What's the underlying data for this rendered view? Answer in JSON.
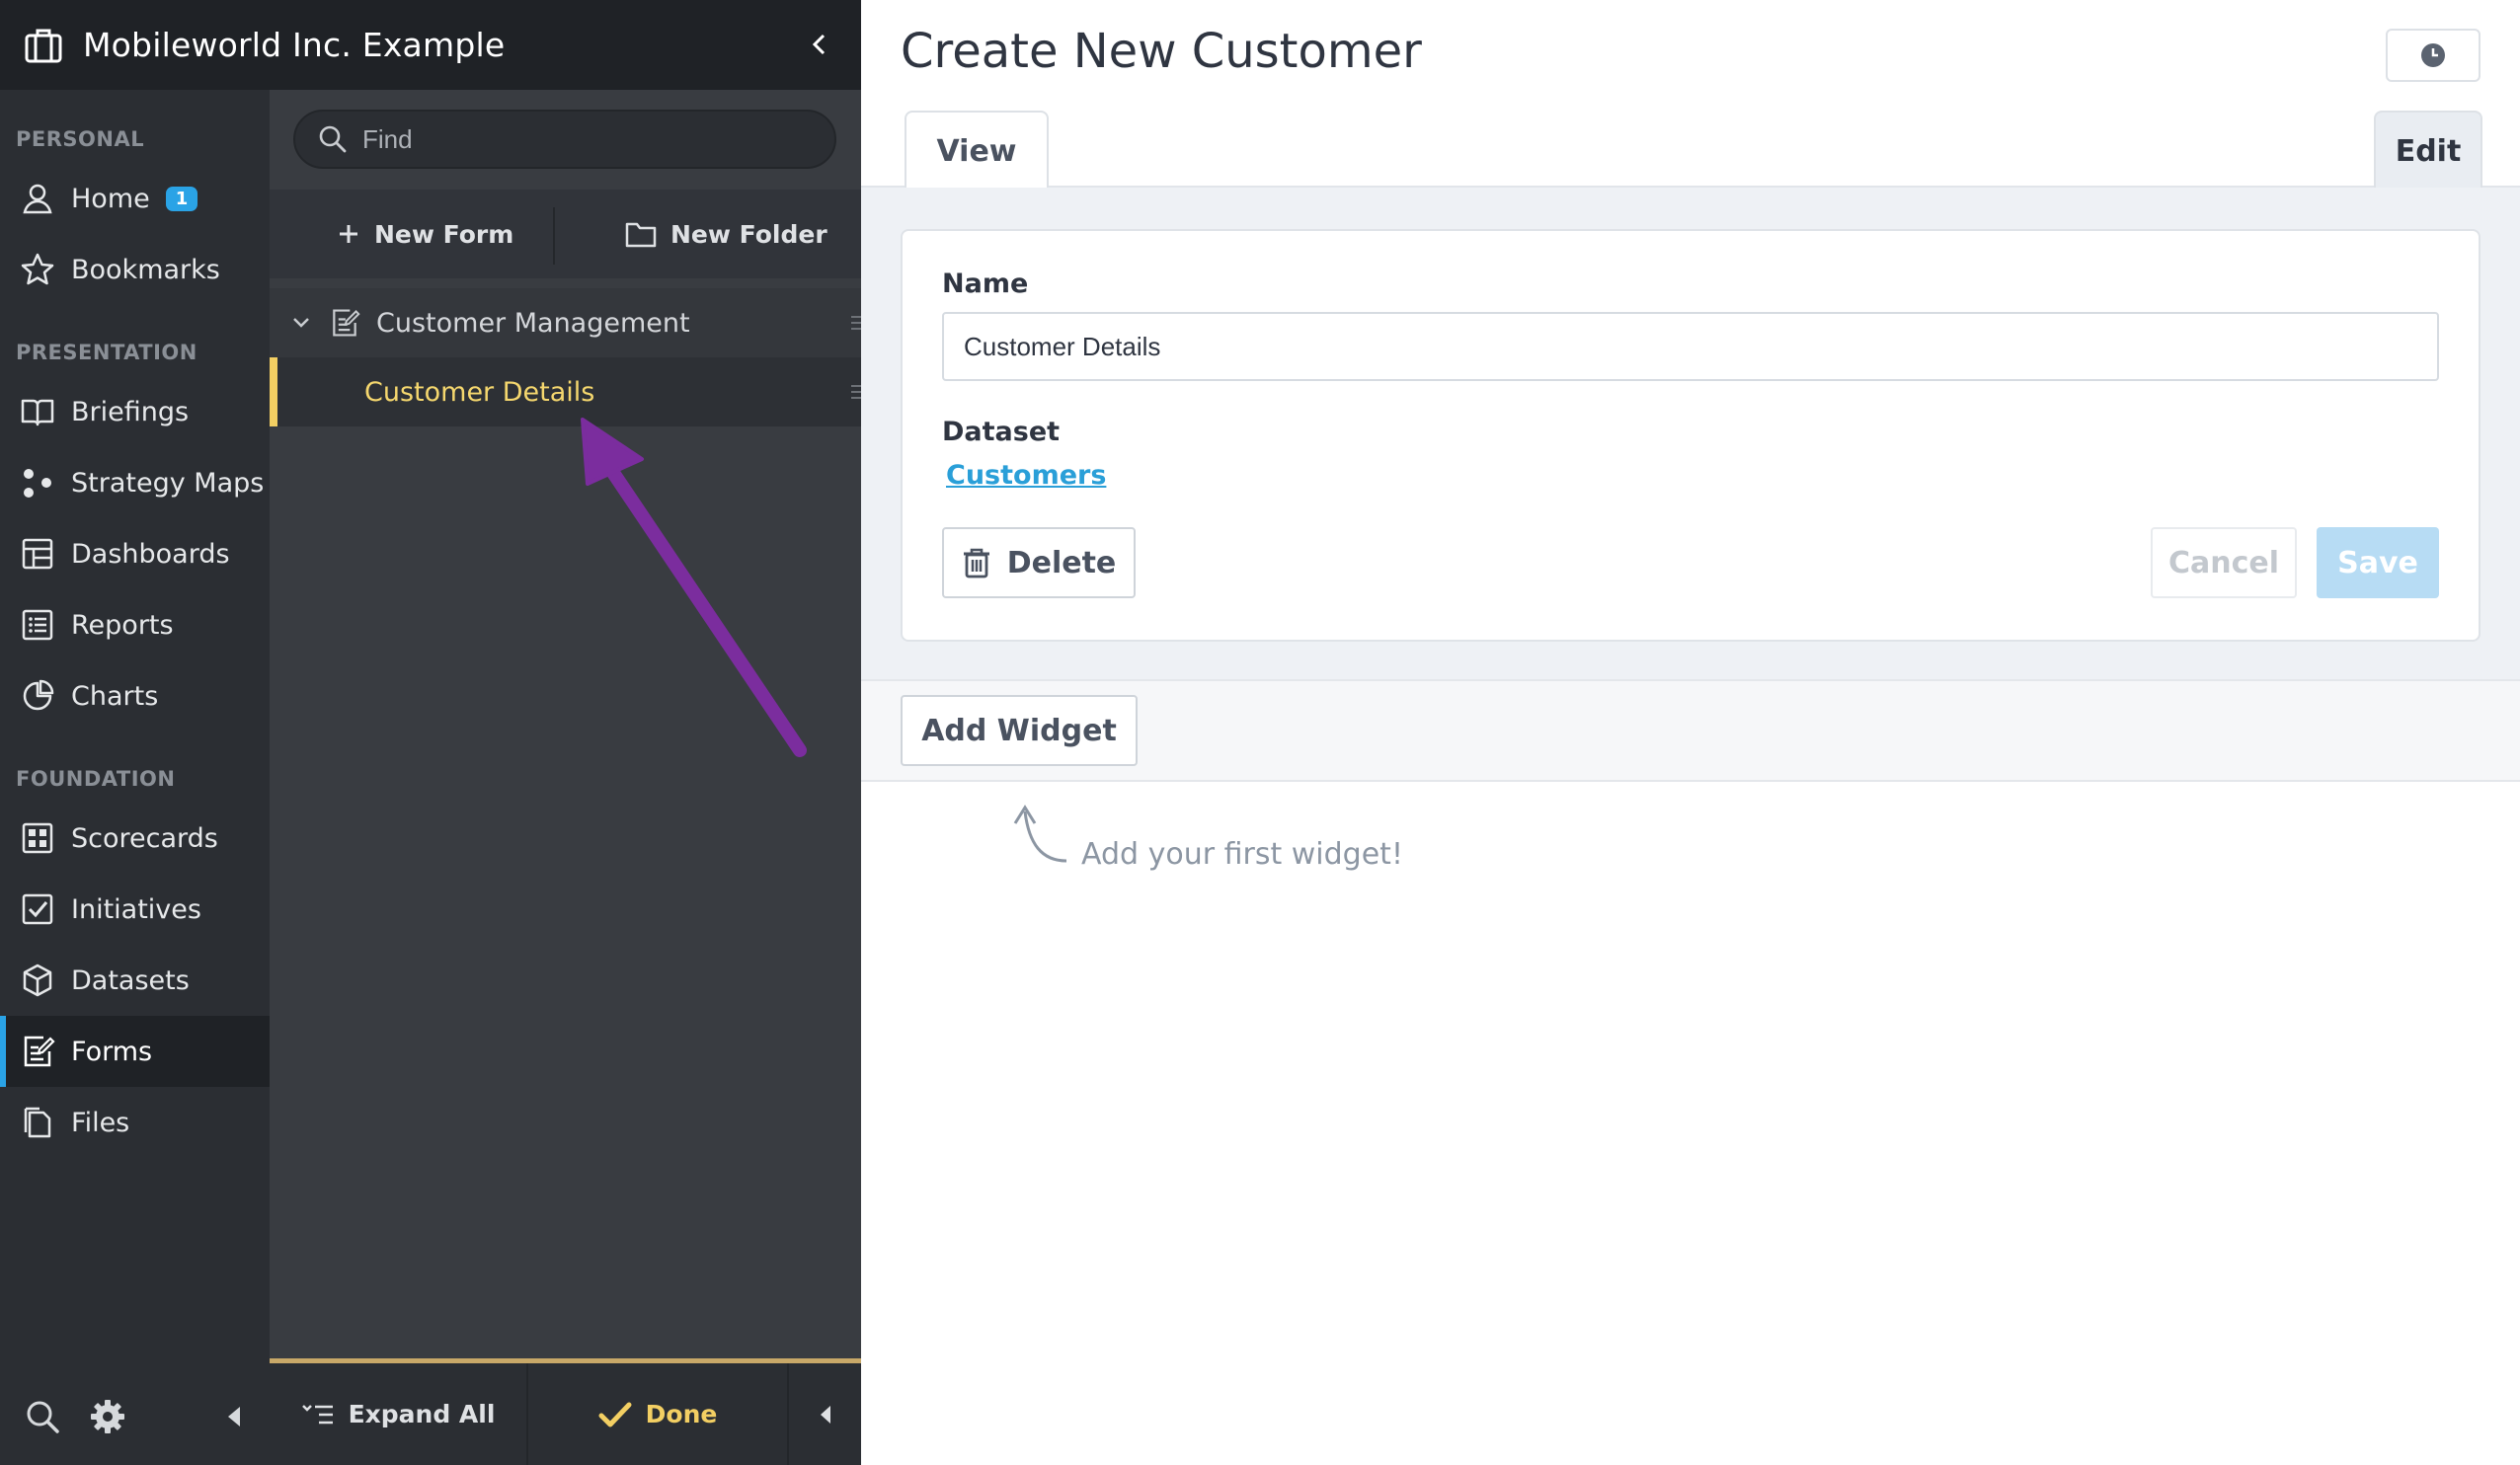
{
  "org": {
    "name": "Mobileworld Inc. Example"
  },
  "nav": {
    "sections": {
      "personal": "PERSONAL",
      "presentation": "PRESENTATION",
      "foundation": "FOUNDATION"
    },
    "items": {
      "home": {
        "label": "Home",
        "badge": "1"
      },
      "bookmarks": {
        "label": "Bookmarks"
      },
      "briefings": {
        "label": "Briefings"
      },
      "strategy_maps": {
        "label": "Strategy Maps"
      },
      "dashboards": {
        "label": "Dashboards"
      },
      "reports": {
        "label": "Reports"
      },
      "charts": {
        "label": "Charts"
      },
      "scorecards": {
        "label": "Scorecards"
      },
      "initiatives": {
        "label": "Initiatives"
      },
      "datasets": {
        "label": "Datasets"
      },
      "forms": {
        "label": "Forms",
        "active": true
      },
      "files": {
        "label": "Files"
      }
    }
  },
  "tree": {
    "search_placeholder": "Find",
    "new_form": "New Form",
    "new_folder": "New Folder",
    "group": "Customer Management",
    "selected_item": "Customer Details",
    "expand_all": "Expand All",
    "done": "Done"
  },
  "main": {
    "title": "Create New Customer",
    "tabs": {
      "view": "View",
      "edit": "Edit"
    },
    "form": {
      "name_label": "Name",
      "name_value": "Customer Details",
      "dataset_label": "Dataset",
      "dataset_link": "Customers",
      "delete": "Delete",
      "cancel": "Cancel",
      "save": "Save"
    },
    "add_widget": "Add Widget",
    "hint": "Add your first widget!"
  },
  "colors": {
    "accent_blue": "#2aa3e6",
    "selection_yellow": "#f3cf63",
    "annotation_arrow": "#7b2d9e"
  }
}
